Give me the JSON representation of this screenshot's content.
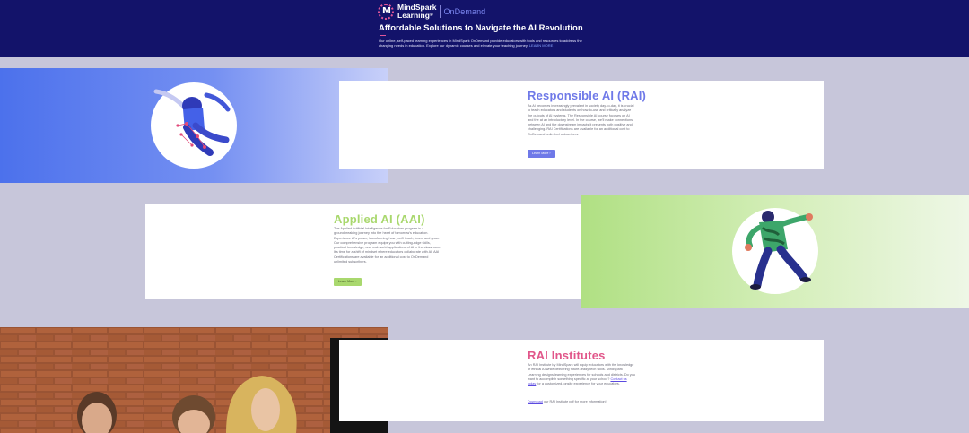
{
  "header": {
    "logo_mark": "M",
    "logo_line1": "MindSpark",
    "logo_line2": "Learning",
    "logo_reg": "®",
    "logo_product": "OnDemand",
    "title": "Affordable Solutions to Navigate the AI Revolution",
    "description": "Our online, self-paced learning experiences in MindSpark OnDemand provide educators with tools and resources to address the changing needs in education. Explore our dynamic courses and elevate your teaching journey.",
    "learn_more_link": "LEARN MORE"
  },
  "sections": [
    {
      "title": "Responsible AI (RAI)",
      "body": "As AI becomes increasingly prevalent in society day-to-day, it is crucial to teach educators and students on how-to-use and critically analyze the outputs of AI systems. The Responsible AI course focuses on AI and the at an introductory level. In the course, we'll make connections between AI and the downstream impacts it presents both positive and challenging. RAI Certifications are available for an additional cost to OnDemand unlimited subscribers.",
      "button": "Learn More",
      "chevron": "›",
      "color": "#6f79e8"
    },
    {
      "title": "Applied AI (AAI)",
      "body": "The Applied Artificial Intelligence for Educators program is a groundbreaking journey into the heart of tomorrow's education. Experience AI's power, transforming how you'll teach, learn, and grow. Our comprehensive program equips you with cutting-edge skills, practical knowledge, and real-world applications of AI in the classroom. It's time for a shift of mindset where educators collaborate with AI. AAI Certifications are available for an additional cost to OnDemand unlimited subscribers.",
      "button": "Learn More",
      "chevron": "›",
      "color": "#a9d86e"
    },
    {
      "title": "RAI Institutes",
      "body_pre": "An RAI Institute by MindSpark will equip educators with the knowledge of ethical AI while delivering future-ready tech skills. MindSpark Learning designs learning experiences for schools and districts. Do you want to accomplish something specific at your school?",
      "contact_link": "Contact us today",
      "body_post": "for a customized, onsite experience for your educators.",
      "download_link": "Download",
      "download_text": "our RAI Institute pdf for more information!",
      "color": "#e1568a"
    }
  ]
}
